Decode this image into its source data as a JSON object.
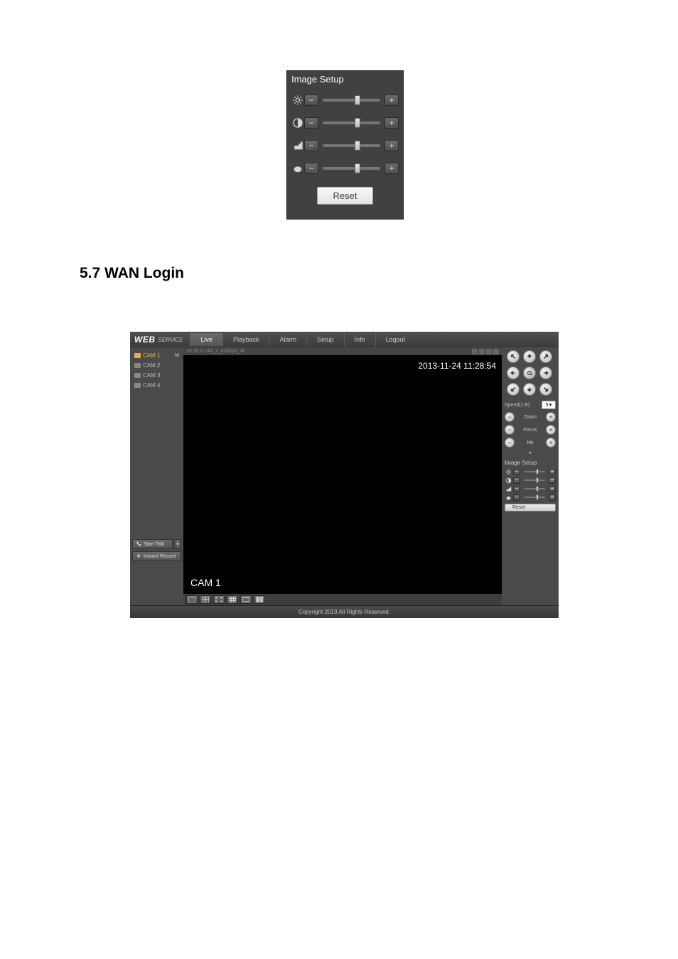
{
  "image_setup_panel": {
    "title": "Image Setup",
    "reset_label": "Reset",
    "sliders": {
      "brightness": {
        "pos": 55
      },
      "contrast": {
        "pos": 55
      },
      "saturation": {
        "pos": 55
      },
      "hue": {
        "pos": 55
      }
    }
  },
  "section_heading": "5.7  WAN Login",
  "app": {
    "logo": "WEB",
    "logo_sub": "SERVICE",
    "nav": {
      "live": "Live",
      "playback": "Playback",
      "alarm": "Alarm",
      "setup": "Setup",
      "info": "Info",
      "logout": "Logout"
    },
    "sidebar": {
      "cams": [
        {
          "label": "CAM 1",
          "active": true,
          "suffix": "M"
        },
        {
          "label": "CAM 2",
          "active": false,
          "suffix": ""
        },
        {
          "label": "CAM 3",
          "active": false,
          "suffix": ""
        },
        {
          "label": "CAM 4",
          "active": false,
          "suffix": ""
        }
      ],
      "start_talk": "Start Talk",
      "instant_record": "Instant Record"
    },
    "main": {
      "info_text": "10.15.6.144_1_62Kbps_M",
      "timestamp": "2013-11-24 11:28:54",
      "cam_label": "CAM 1"
    },
    "ptz": {
      "speed_label": "Speed(1-8):",
      "speed_value": "5",
      "zoom_label": "Zoom",
      "focus_label": "Focus",
      "iris_label": "Iris"
    },
    "mini_image_setup": {
      "title": "Image Setup",
      "reset_label": "Reset"
    },
    "footer": "Copyright 2013,All Rights Reserved."
  }
}
